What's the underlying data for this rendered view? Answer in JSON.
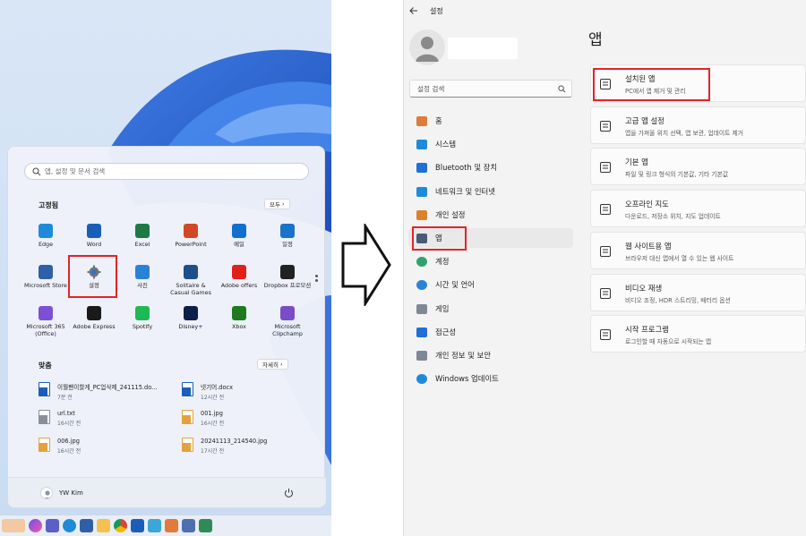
{
  "start_menu": {
    "search_placeholder": "앱, 설정 및 문서 검색",
    "pinned_title": "고정됨",
    "all_button": "모두",
    "pinned_apps": [
      {
        "label": "Edge",
        "icon": "edge-icon",
        "color": "#1f8ad8"
      },
      {
        "label": "Word",
        "icon": "word-icon",
        "color": "#1b5eb8"
      },
      {
        "label": "Excel",
        "icon": "excel-icon",
        "color": "#1d7a45"
      },
      {
        "label": "PowerPoint",
        "icon": "powerpoint-icon",
        "color": "#d24726"
      },
      {
        "label": "메일",
        "icon": "mail-icon",
        "color": "#1170cf"
      },
      {
        "label": "일정",
        "icon": "calendar-icon",
        "color": "#1a73c8"
      },
      {
        "label": "Microsoft Store",
        "icon": "store-icon",
        "color": "#2f5fa8"
      },
      {
        "label": "설정",
        "icon": "gear-icon",
        "color": "#6d7580"
      },
      {
        "label": "사진",
        "icon": "photos-icon",
        "color": "#2a82d7"
      },
      {
        "label": "Solitaire & Casual Games",
        "icon": "solitaire-icon",
        "color": "#1d4f8a"
      },
      {
        "label": "Adobe offers",
        "icon": "adobe-icon",
        "color": "#e0201b"
      },
      {
        "label": "Dropbox 프로모션",
        "icon": "dropbox-icon",
        "color": "#222222"
      },
      {
        "label": "Microsoft 365 (Office)",
        "icon": "m365-icon",
        "color": "#7b4fd6"
      },
      {
        "label": "Adobe Express",
        "icon": "adobe-express-icon",
        "color": "#1a1a1a"
      },
      {
        "label": "Spotify",
        "icon": "spotify-icon",
        "color": "#1db954"
      },
      {
        "label": "Disney+",
        "icon": "disney-icon",
        "color": "#0b1f4a"
      },
      {
        "label": "Xbox",
        "icon": "xbox-icon",
        "color": "#1f7a1f"
      },
      {
        "label": "Microsoft Clipchamp",
        "icon": "clipchamp-icon",
        "color": "#7a4cc9"
      }
    ],
    "recommended_title": "맞춤",
    "more_button": "자세히",
    "recommended": [
      {
        "name": "이월팬이할게_PC업삭제_241115.do...",
        "time": "7분 전",
        "icon": "word-file-icon",
        "color": "#1b5eb8"
      },
      {
        "name": "넷기어.docx",
        "time": "12시간 전",
        "icon": "word-file-icon",
        "color": "#1b5eb8"
      },
      {
        "name": "url.txt",
        "time": "16시간 전",
        "icon": "text-file-icon",
        "color": "#8a8f98"
      },
      {
        "name": "001.jpg",
        "time": "16시간 전",
        "icon": "image-file-icon",
        "color": "#e3a23b"
      },
      {
        "name": "006.jpg",
        "time": "16시간 전",
        "icon": "image-file-icon",
        "color": "#e3a23b"
      },
      {
        "name": "20241113_214540.jpg",
        "time": "17시간 전",
        "icon": "image-file-icon",
        "color": "#e3a23b"
      }
    ],
    "user_name": "YW Kim"
  },
  "settings": {
    "window_title": "설정",
    "search_placeholder": "설정 검색",
    "page_title": "앱",
    "nav": [
      {
        "label": "홈",
        "icon": "home-icon",
        "color": "#e07b39"
      },
      {
        "label": "시스템",
        "icon": "system-icon",
        "color": "#1f8ad8"
      },
      {
        "label": "Bluetooth 및 장치",
        "icon": "bluetooth-icon",
        "color": "#1f6fd6"
      },
      {
        "label": "네트워크 및 인터넷",
        "icon": "wifi-icon",
        "color": "#1f8ad8"
      },
      {
        "label": "개인 설정",
        "icon": "brush-icon",
        "color": "#d9822b"
      },
      {
        "label": "앱",
        "icon": "apps-icon",
        "color": "#4a5a78"
      },
      {
        "label": "계정",
        "icon": "account-icon",
        "color": "#2fa36b"
      },
      {
        "label": "시간 및 언어",
        "icon": "globe-icon",
        "color": "#2a82d7"
      },
      {
        "label": "게임",
        "icon": "gamepad-icon",
        "color": "#7f8894"
      },
      {
        "label": "접근성",
        "icon": "accessibility-icon",
        "color": "#1f6fd6"
      },
      {
        "label": "개인 정보 및 보안",
        "icon": "shield-icon",
        "color": "#7f8894"
      },
      {
        "label": "Windows 업데이트",
        "icon": "update-icon",
        "color": "#1f8ad8"
      }
    ],
    "cards": [
      {
        "title": "설치된 앱",
        "desc": "PC에서 앱 제거 및 관리",
        "icon": "installed-apps-icon"
      },
      {
        "title": "고급 앱 설정",
        "desc": "앱을 가져올 위치 선택, 앱 보관, 업데이트 제거",
        "icon": "advanced-apps-icon"
      },
      {
        "title": "기본 앱",
        "desc": "파일 및 링크 형식의 기본값, 기타 기본값",
        "icon": "default-apps-icon"
      },
      {
        "title": "오프라인 지도",
        "desc": "다운로드, 저장소 위치, 지도 업데이트",
        "icon": "offline-maps-icon"
      },
      {
        "title": "웹 사이트용 앱",
        "desc": "브라우저 대신 앱에서 열 수 있는 웹 사이트",
        "icon": "web-apps-icon"
      },
      {
        "title": "비디오 재생",
        "desc": "비디오 조정, HDR 스트리밍, 배터리 옵션",
        "icon": "video-icon"
      },
      {
        "title": "시작 프로그램",
        "desc": "로그인할 때 자동으로 시작되는 앱",
        "icon": "startup-icon"
      }
    ]
  },
  "colors": {
    "highlight": "#e0242a",
    "accent": "#1f6fd6"
  }
}
